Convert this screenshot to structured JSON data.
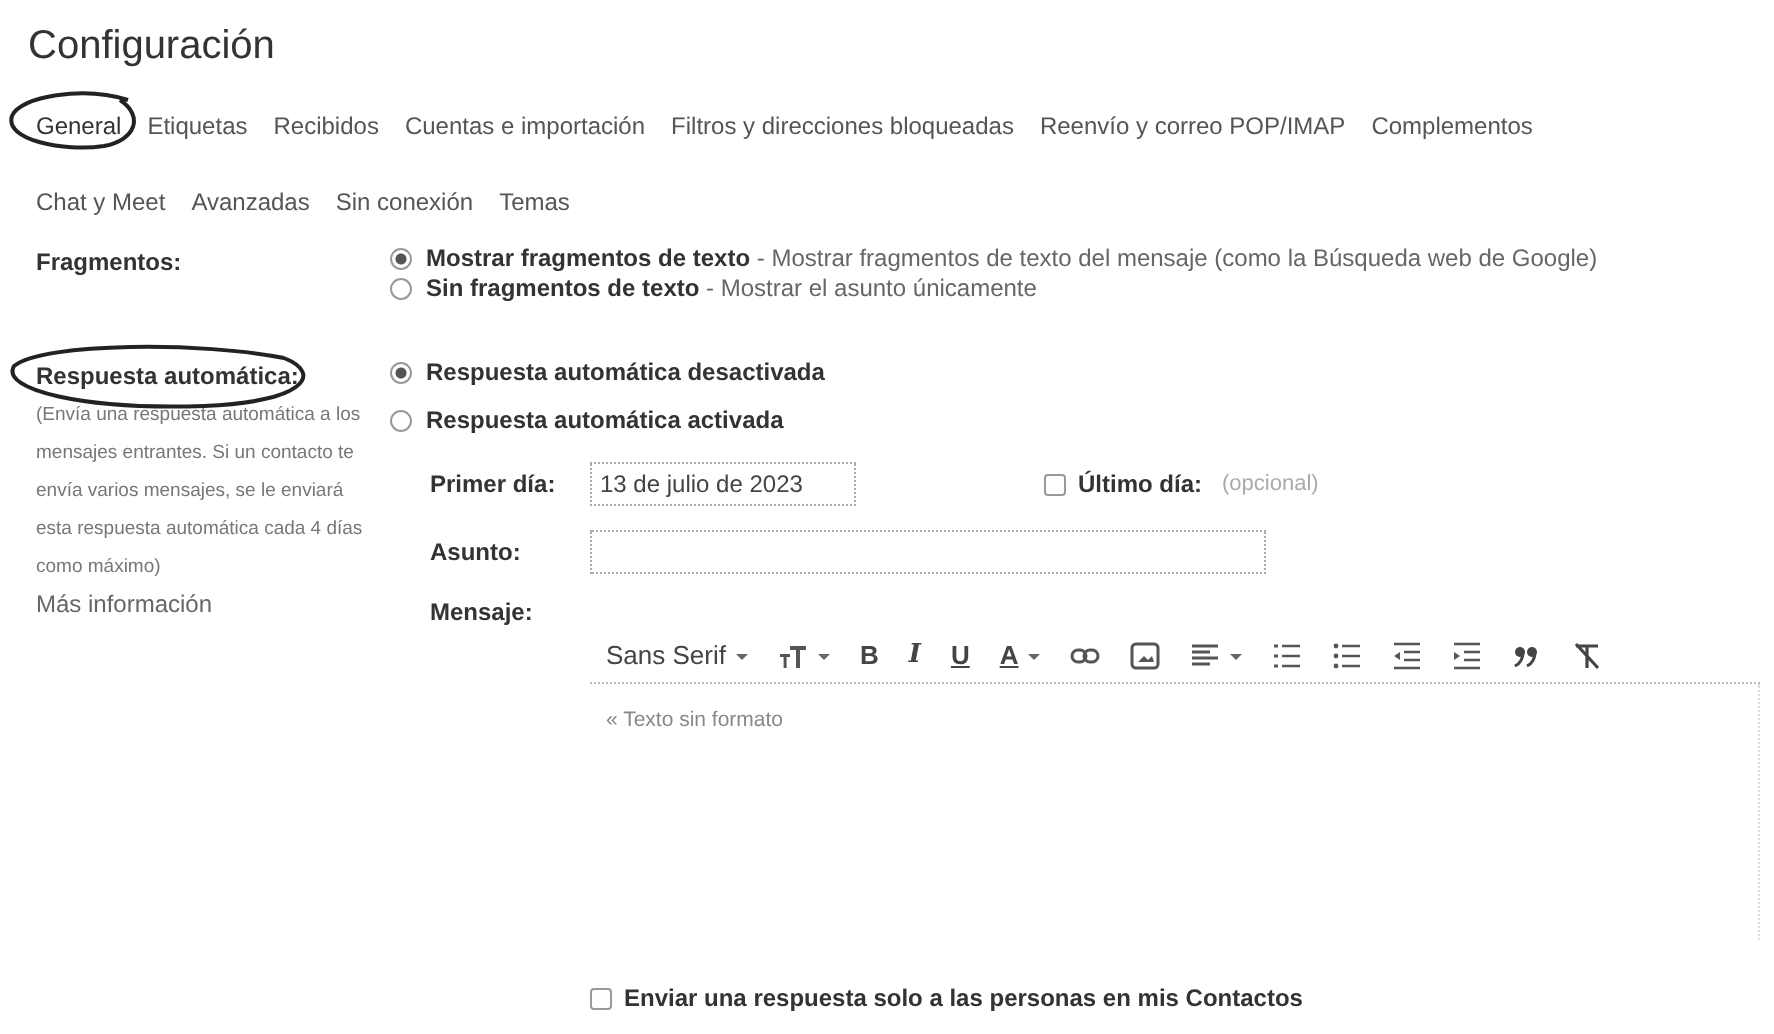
{
  "title": "Configuración",
  "tabs": [
    {
      "label": "General",
      "selected": true,
      "circled": true
    },
    {
      "label": "Etiquetas",
      "selected": false,
      "circled": false
    },
    {
      "label": "Recibidos",
      "selected": false,
      "circled": false
    },
    {
      "label": "Cuentas e importación",
      "selected": false,
      "circled": false
    },
    {
      "label": "Filtros y direcciones bloqueadas",
      "selected": false,
      "circled": false
    },
    {
      "label": "Reenvío y correo POP/IMAP",
      "selected": false,
      "circled": false
    },
    {
      "label": "Complementos",
      "selected": false,
      "circled": false
    },
    {
      "label": "Chat y Meet",
      "selected": false,
      "circled": false
    },
    {
      "label": "Avanzadas",
      "selected": false,
      "circled": false
    },
    {
      "label": "Sin conexión",
      "selected": false,
      "circled": false
    },
    {
      "label": "Temas",
      "selected": false,
      "circled": false
    }
  ],
  "snippets": {
    "label": "Fragmentos:",
    "options": [
      {
        "title": "Mostrar fragmentos de texto",
        "description": "- Mostrar fragmentos de texto del mensaje (como la Búsqueda web de Google)",
        "selected": true
      },
      {
        "title": "Sin fragmentos de texto",
        "description": "- Mostrar el asunto únicamente",
        "selected": false
      }
    ]
  },
  "autoreply": {
    "label": "Respuesta automática:",
    "circled": true,
    "help": "(Envía una respuesta automática a los mensajes entrantes. Si un contacto te envía varios mensajes, se le enviará esta respuesta automática cada 4 días como máximo)",
    "more_link": "Más información",
    "options": [
      {
        "title": "Respuesta automática desactivada",
        "selected": true
      },
      {
        "title": "Respuesta automática activada",
        "selected": false
      }
    ],
    "first_day": {
      "label": "Primer día:",
      "value": "13 de julio de 2023"
    },
    "last_day": {
      "label": "Último día:",
      "placeholder": "(opcional)",
      "checked": false
    },
    "subject": {
      "label": "Asunto:"
    },
    "message": {
      "label": "Mensaje:",
      "plain_text_link": "« Texto sin formato",
      "toolbar": [
        {
          "kind": "text",
          "label": "Sans Serif",
          "dropdown": true
        },
        {
          "kind": "icon",
          "dropdown": true
        },
        {
          "kind": "bold",
          "label": "B",
          "dropdown": false
        },
        {
          "kind": "italic",
          "label": "I",
          "dropdown": false
        },
        {
          "kind": "underline",
          "label": "U",
          "dropdown": false
        },
        {
          "kind": "underline",
          "label": "A",
          "dropdown": true
        },
        {
          "kind": "icon",
          "dropdown": false
        },
        {
          "kind": "icon",
          "dropdown": false
        },
        {
          "kind": "icon",
          "dropdown": true
        },
        {
          "kind": "icon",
          "dropdown": false
        },
        {
          "kind": "icon",
          "dropdown": false
        },
        {
          "kind": "icon",
          "dropdown": false
        },
        {
          "kind": "icon",
          "dropdown": false
        },
        {
          "kind": "icon",
          "dropdown": false
        },
        {
          "kind": "icon",
          "dropdown": false
        }
      ]
    },
    "contacts_only": {
      "label": "Enviar una respuesta solo a las personas en mis Contactos",
      "checked": false
    }
  }
}
